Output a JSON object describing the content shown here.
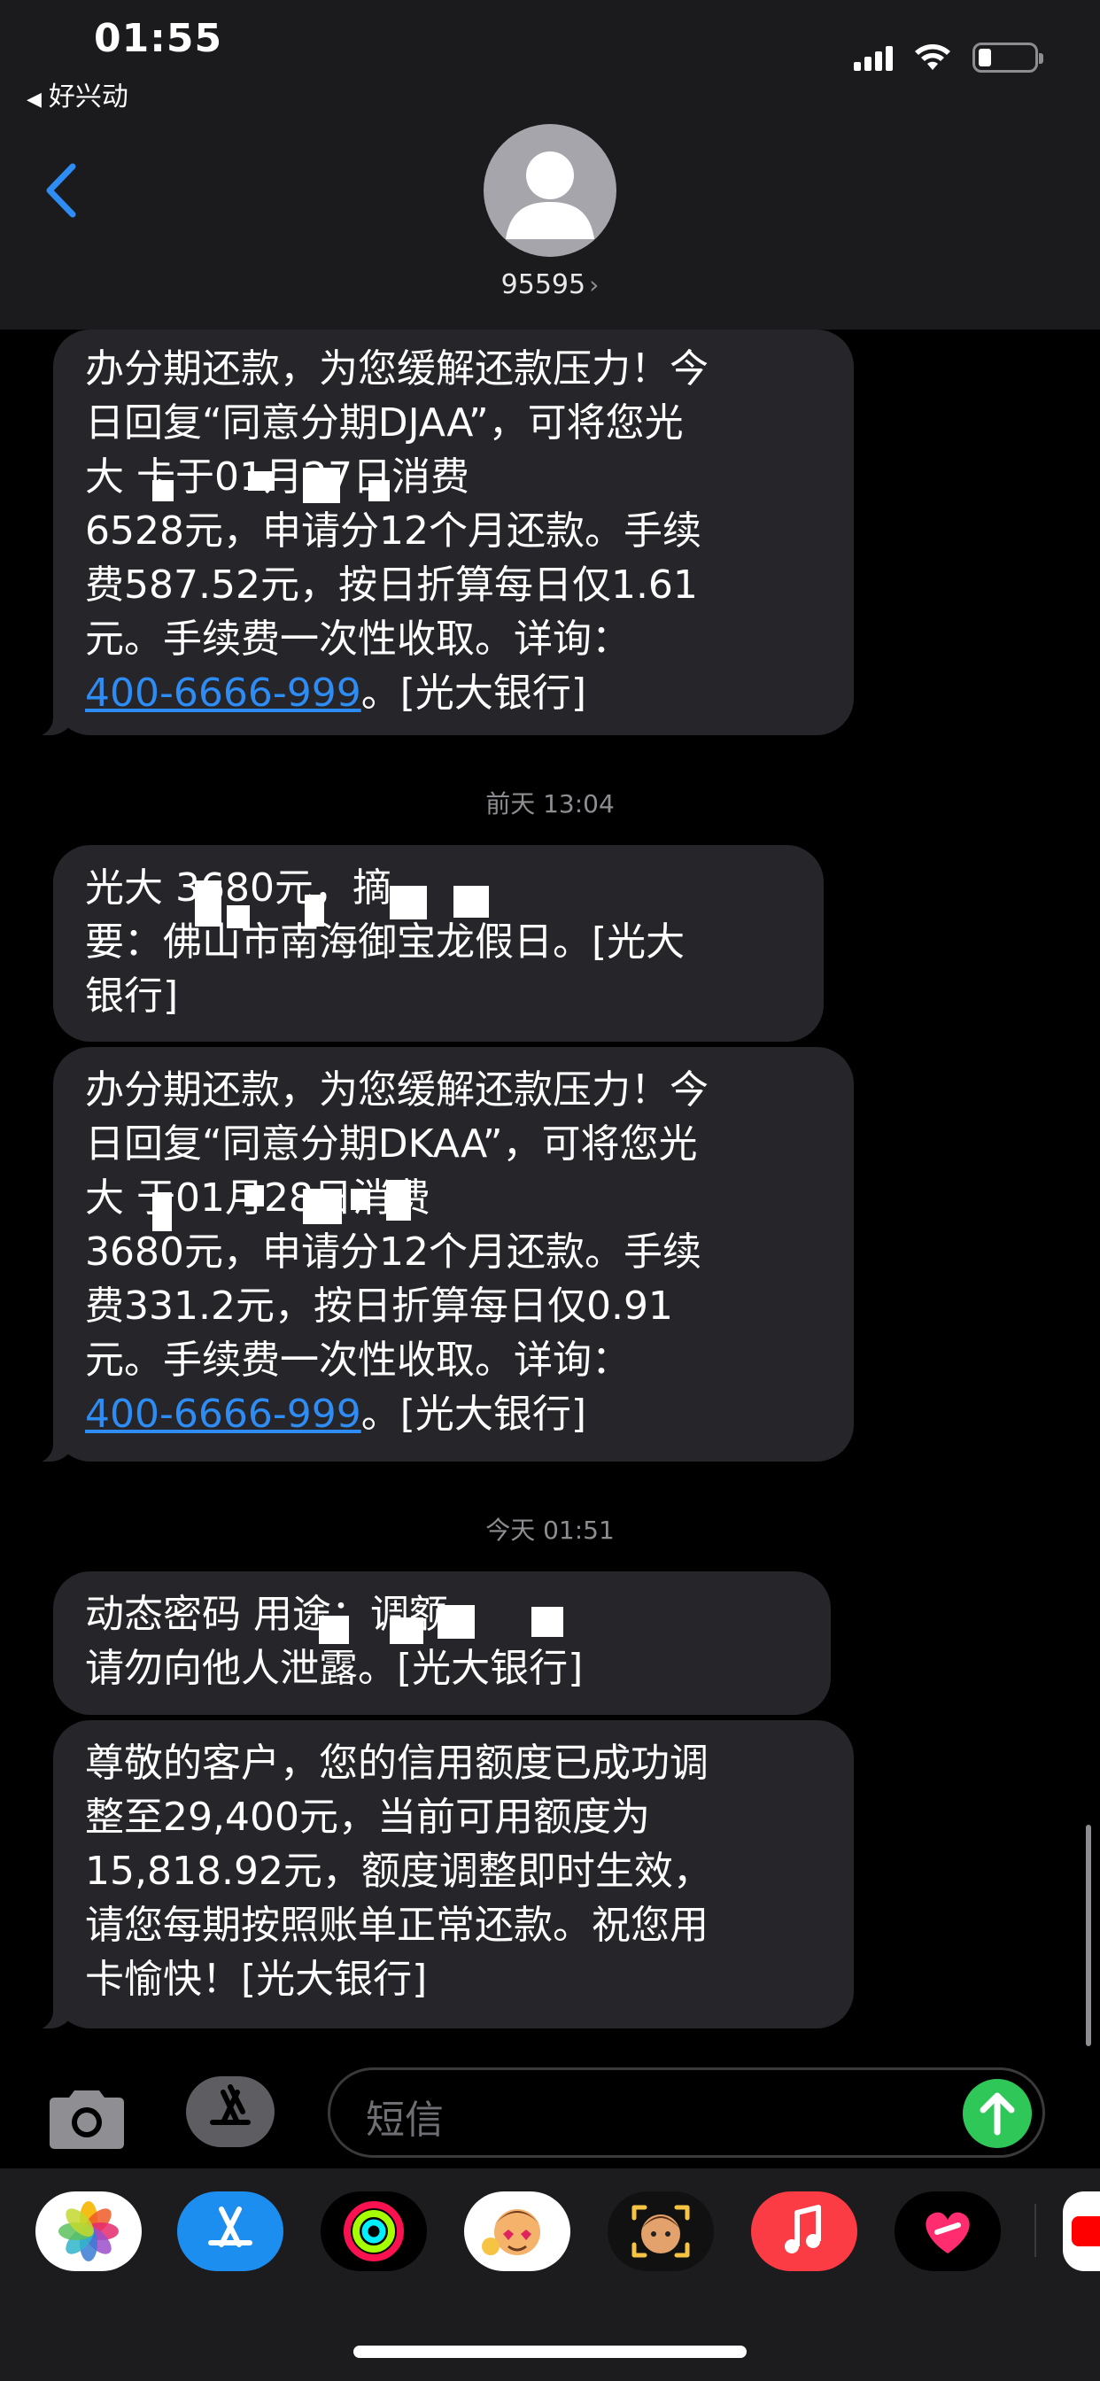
{
  "status_bar": {
    "time": "01:55",
    "back_app_label": "好兴动"
  },
  "header": {
    "contact_name": "95595"
  },
  "messages": [
    {
      "lines": [
        "办分期还款，为您缓解还款压力！今",
        "日回复“同意分期DJAA”，可将您光",
        "大 卡于01月27日消费",
        "6528元，申请分12个月还款。手续",
        "费587.52元，按日折算每日仅1.61",
        "元。手续费一次性收取。详询："
      ],
      "link": "400-6666-999",
      "suffix": "。[光大银行]"
    },
    {
      "timestamp": "前天 13:04"
    },
    {
      "lines": [
        "光大 3680元，摘",
        "要：佛山市南海御宝龙假日。[光大",
        "银行]"
      ]
    },
    {
      "lines": [
        "办分期还款，为您缓解还款压力！今",
        "日回复“同意分期DKAA”，可将您光",
        "大 于01月28日消费",
        "3680元，申请分12个月还款。手续",
        "费331.2元，按日折算每日仅0.91",
        "元。手续费一次性收取。详询："
      ],
      "link": "400-6666-999",
      "suffix": "。[光大银行]"
    },
    {
      "timestamp": "今天 01:51"
    },
    {
      "lines": [
        "动态密码 用途：调额，",
        "请勿向他人泄露。[光大银行]"
      ]
    },
    {
      "lines": [
        "尊敬的客户，您的信用额度已成功调",
        "整至29,400元，当前可用额度为",
        "15,818.92元，额度调整即时生效，",
        "请您每期按照账单正常还款。祝您用",
        "卡愉快！[光大银行]"
      ]
    }
  ],
  "input": {
    "placeholder": "短信"
  },
  "app_drawer": [
    {
      "name": "photos-icon"
    },
    {
      "name": "app-store-icon"
    },
    {
      "name": "activity-icon"
    },
    {
      "name": "memoji-stickers-icon"
    },
    {
      "name": "memoji-icon"
    },
    {
      "name": "music-icon"
    },
    {
      "name": "heart-app-icon"
    },
    {
      "name": "youtube-icon"
    }
  ],
  "colors": {
    "bubble": "#26252a",
    "link": "#2e8cf5",
    "send": "#30c759",
    "header": "#1b1b1d"
  }
}
